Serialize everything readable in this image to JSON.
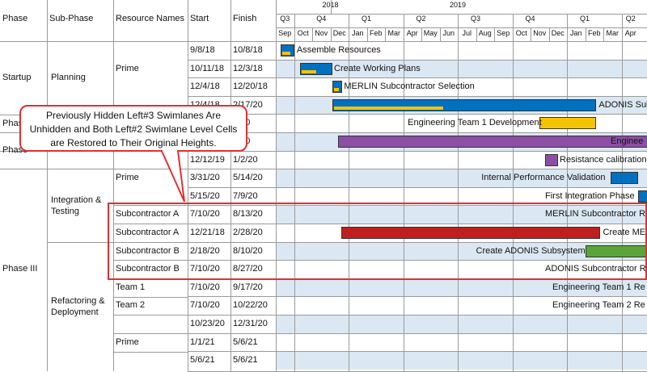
{
  "columns": {
    "phase": "Phase",
    "subphase": "Sub-Phase",
    "resource": "Resource Names",
    "start": "Start",
    "finish": "Finish"
  },
  "timeline": {
    "years": [
      "2018",
      "2019"
    ],
    "quarters": [
      "Q3",
      "Q4",
      "Q1",
      "Q2",
      "Q3",
      "Q4",
      "Q1",
      "Q2"
    ],
    "months": [
      "Sep",
      "Oct",
      "Nov",
      "Dec",
      "Jan",
      "Feb",
      "Mar",
      "Apr",
      "May",
      "Jun",
      "Jul",
      "Aug",
      "Sep",
      "Oct",
      "Nov",
      "Dec",
      "Jan",
      "Feb",
      "Mar",
      "Apr"
    ]
  },
  "phases": [
    "Startup",
    "Phas",
    "Phase",
    "Phase III"
  ],
  "subphases": [
    "Planning",
    "Integration & Testing",
    "Refactoring & Deployment"
  ],
  "rows": [
    {
      "resource": "",
      "start": "9/8/18",
      "finish": "10/8/18",
      "task": "Assemble Resources"
    },
    {
      "resource": "Prime",
      "start": "10/11/18",
      "finish": "12/3/18",
      "task": "Create Working Plans"
    },
    {
      "resource": "",
      "start": "12/4/18",
      "finish": "12/20/18",
      "task": "MERLIN Subcontractor Selection"
    },
    {
      "resource": "",
      "start": "12/4/18",
      "finish": "2/17/20",
      "task": "ADONIS Subco"
    },
    {
      "resource": "",
      "start": "",
      "finish": "1/20",
      "task": "Engineering Team 1 Development"
    },
    {
      "resource": "",
      "start": "",
      "finish": "0/20",
      "task": "Enginee"
    },
    {
      "resource": "",
      "start": "12/12/19",
      "finish": "1/2/20",
      "task": "Resistance calibration"
    },
    {
      "resource": "Prime",
      "start": "3/31/20",
      "finish": "5/14/20",
      "task": "Internal Performance Validation"
    },
    {
      "resource": "",
      "start": "5/15/20",
      "finish": "7/9/20",
      "task": "First Integration Phase"
    },
    {
      "resource": "Subcontractor A",
      "start": "7/10/20",
      "finish": "8/13/20",
      "task": "MERLIN Subcontractor Re"
    },
    {
      "resource": "Subcontractor A",
      "start": "12/21/18",
      "finish": "2/28/20",
      "task": "Create MERL"
    },
    {
      "resource": "Subcontractor B",
      "start": "2/18/20",
      "finish": "8/10/20",
      "task": "Create ADONIS Subsystem"
    },
    {
      "resource": "Subcontractor B",
      "start": "7/10/20",
      "finish": "8/27/20",
      "task": "ADONIS Subcontractor Re"
    },
    {
      "resource": "Team 1",
      "start": "7/10/20",
      "finish": "9/17/20",
      "task": "Engineering Team 1 Re"
    },
    {
      "resource": "Team 2",
      "start": "7/10/20",
      "finish": "10/22/20",
      "task": "Engineering Team 2 Re"
    },
    {
      "resource": "",
      "start": "10/23/20",
      "finish": "12/31/20",
      "task": ""
    },
    {
      "resource": "Prime",
      "start": "1/1/21",
      "finish": "5/6/21",
      "task": ""
    },
    {
      "resource": "",
      "start": "5/6/21",
      "finish": "5/6/21",
      "task": ""
    }
  ],
  "callout": {
    "line1": "Previously Hidden Left#3 Swimlanes Are",
    "line2": "Unhidden and Both Left#2 Swimlane Level Cells",
    "line3": "are Restored to Their Original Heights."
  },
  "colors": {
    "blue": "#0070c0",
    "yellow": "#f5c400",
    "purple": "#8c4fa3",
    "red": "#c01f1f",
    "green": "#5aa43a",
    "highlight": "#e03030",
    "rowband": "#dbe8f4"
  }
}
